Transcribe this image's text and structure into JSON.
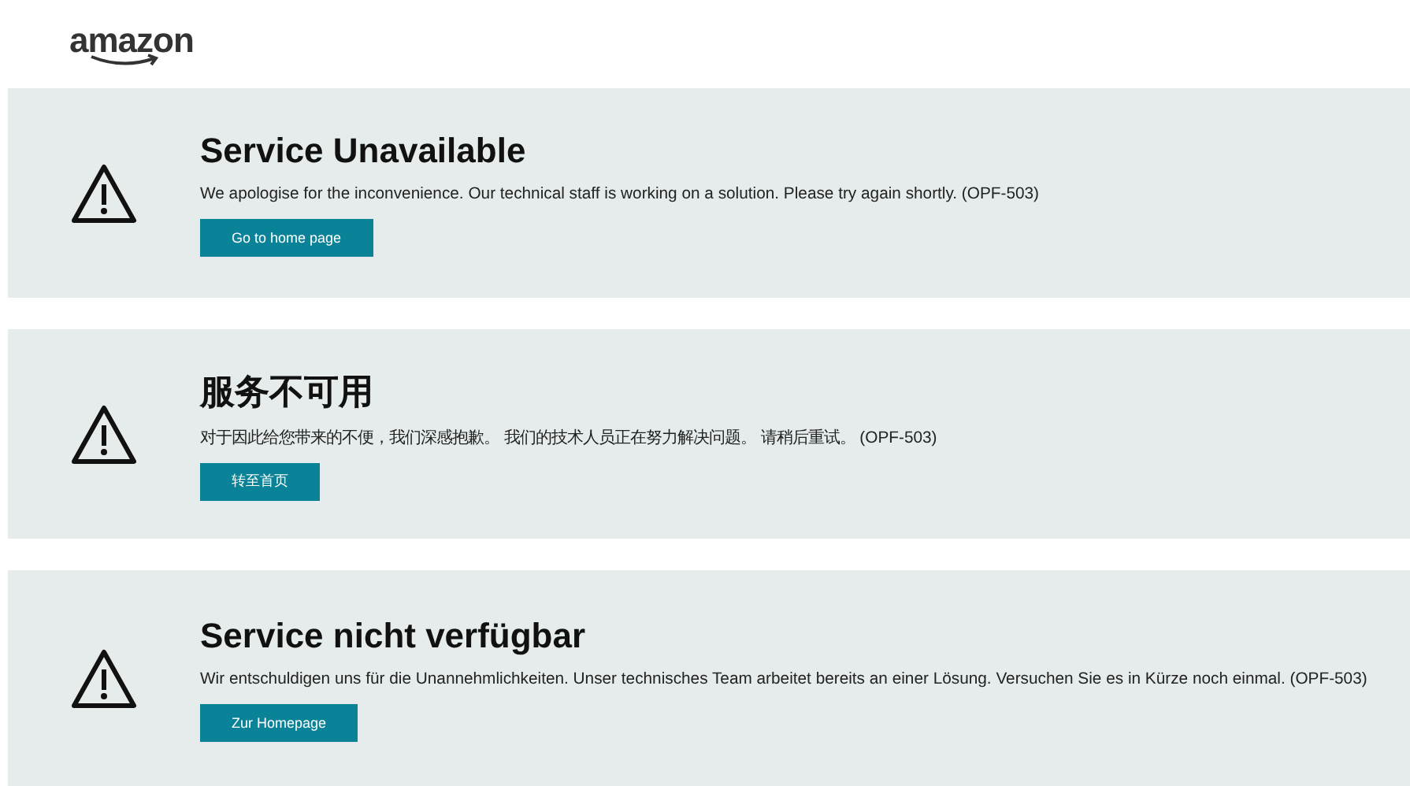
{
  "logo": {
    "text": "amazon"
  },
  "panels": [
    {
      "title": "Service Unavailable",
      "message": "We apologise for the inconvenience. Our technical staff is working on a solution. Please try again shortly. (OPF-503)",
      "button": "Go to home page"
    },
    {
      "title": "服务不可用",
      "message": "对于因此给您带来的不便，我们深感抱歉。 我们的技术人员正在努力解决问题。 请稍后重试。 (OPF-503)",
      "button": "转至首页"
    },
    {
      "title": "Service nicht verfügbar",
      "message": "Wir entschuldigen uns für die Unannehmlichkeiten. Unser technisches Team arbeitet bereits an einer Lösung. Versuchen Sie es in Kürze noch einmal. (OPF-503)",
      "button": "Zur Homepage"
    }
  ]
}
